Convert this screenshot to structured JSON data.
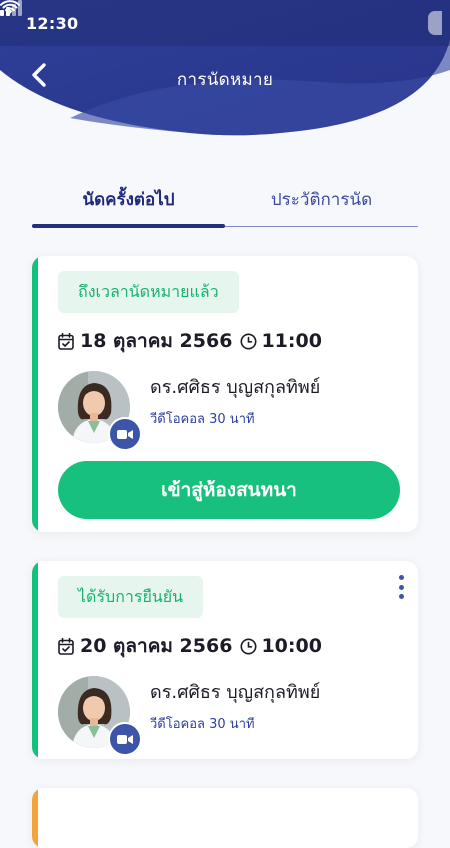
{
  "status_bar": {
    "time": "12:30"
  },
  "header": {
    "title": "การนัดหมาย",
    "back_icon": "chevron-left-icon"
  },
  "tabs": [
    {
      "label": "นัดครั้งต่อไป",
      "active": true
    },
    {
      "label": "ประวัติการนัด",
      "active": false
    }
  ],
  "appointments": [
    {
      "status": "ถึงเวลานัดหมายแล้ว",
      "date": "18 ตุลาคม 2566",
      "time": "11:00",
      "doctor": "ดร.ศศิธร บุญสกุลทิพย์",
      "call_info": "วีดีโอคอล 30 นาที",
      "action_label": "เข้าสู่ห้องสนทนา"
    },
    {
      "status": "ได้รับการยืนยัน",
      "date": "20 ตุลาคม 2566",
      "time": "10:00",
      "doctor": "ดร.ศศิธร บุญสกุลทิพย์",
      "call_info": "วีดีโอคอล 30 นาที"
    }
  ],
  "colors": {
    "primary": "#2b3a8f",
    "success": "#17c07d",
    "badge_bg": "#e6f6ee",
    "accent_orange": "#f5a33a"
  }
}
